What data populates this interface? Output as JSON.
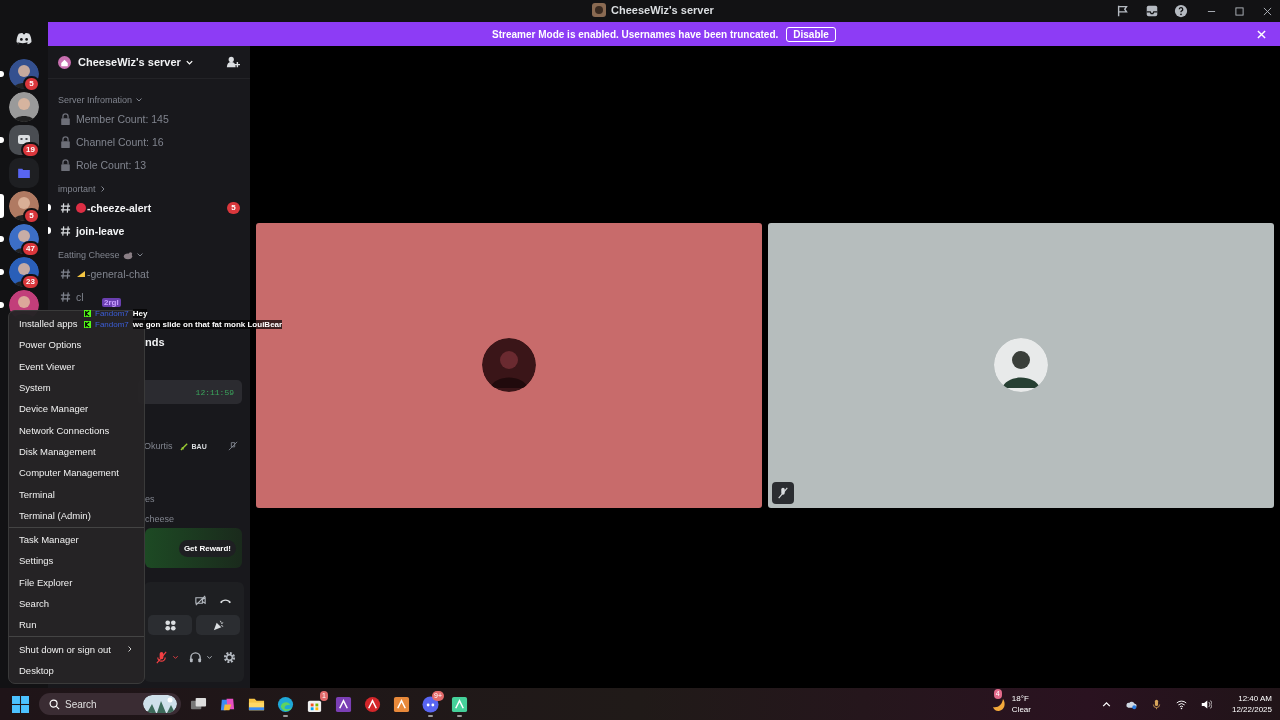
{
  "title_bar": {
    "title": "CheeseWiz's server"
  },
  "banner": {
    "message": "Streamer Mode is enabled. Usernames have been truncated.",
    "button": "Disable"
  },
  "servers": [
    {
      "kind": "picture",
      "badge": "5",
      "unread": true,
      "selected": false
    },
    {
      "kind": "picture",
      "unread": false,
      "selected": false
    },
    {
      "kind": "app",
      "badge": "19",
      "unread": true,
      "selected": false
    },
    {
      "kind": "folder",
      "unread": false,
      "selected": false
    },
    {
      "kind": "picture",
      "badge": "5",
      "selected": true
    },
    {
      "kind": "picture",
      "badge": "47",
      "unread": true,
      "selected": false
    },
    {
      "kind": "picture",
      "badge": "23",
      "unread": true,
      "selected": false
    },
    {
      "kind": "picture",
      "unread": true,
      "selected": false
    }
  ],
  "sidebar": {
    "server_name": "CheeseWiz's server",
    "categories": [
      {
        "name": "Server Infromation",
        "expanded": true,
        "decorated": false,
        "channels": [
          {
            "kind": "locked",
            "name": "Member Count: 145",
            "unread": false
          },
          {
            "kind": "locked",
            "name": "Channel Count: 16",
            "unread": false
          },
          {
            "kind": "locked",
            "name": "Role Count: 13",
            "unread": false
          }
        ]
      },
      {
        "name": "important",
        "expanded": false,
        "decorated": false,
        "channels": [
          {
            "kind": "alert",
            "name": "-cheeze-alert",
            "unread": true,
            "badge": "5"
          },
          {
            "kind": "text",
            "name": "join-leave",
            "unread": true
          }
        ]
      },
      {
        "name": "Eatting Cheese",
        "expanded": true,
        "decorated": true,
        "channels": [
          {
            "kind": "food",
            "name": "-general-chat",
            "unread": false
          },
          {
            "kind": "text",
            "name": "cl",
            "unread": false
          }
        ]
      }
    ],
    "hidden_area": {
      "heading_tail": "nds",
      "timestamp": "12:11:59",
      "member": "Okurtis",
      "member_tag": "BAU",
      "line_a": "es",
      "line_b": "cheese",
      "reward_button": "Get Reward!"
    }
  },
  "overlay_chat": {
    "tag": "2rgl",
    "messages": [
      {
        "author": "Fandom7",
        "text": "Hey"
      },
      {
        "author": "Fandom7",
        "text": "we gon slide on that fat monk LouiBear"
      }
    ]
  },
  "video_tiles": [
    {
      "color": "#c86b6b",
      "muted": false
    },
    {
      "color": "#b6bdbd",
      "muted": true
    }
  ],
  "context_menu": {
    "groups": [
      [
        {
          "label": "Installed apps",
          "submenu": false
        },
        {
          "label": "Power Options",
          "submenu": false
        },
        {
          "label": "Event Viewer",
          "submenu": false
        },
        {
          "label": "System",
          "submenu": false
        },
        {
          "label": "Device Manager",
          "submenu": false
        },
        {
          "label": "Network Connections",
          "submenu": false
        },
        {
          "label": "Disk Management",
          "submenu": false
        },
        {
          "label": "Computer Management",
          "submenu": false
        },
        {
          "label": "Terminal",
          "submenu": false
        },
        {
          "label": "Terminal (Admin)",
          "submenu": false
        }
      ],
      [
        {
          "label": "Task Manager",
          "submenu": false
        },
        {
          "label": "Settings",
          "submenu": false
        },
        {
          "label": "File Explorer",
          "submenu": false
        },
        {
          "label": "Search",
          "submenu": false
        },
        {
          "label": "Run",
          "submenu": false
        }
      ],
      [
        {
          "label": "Shut down or sign out",
          "submenu": true
        },
        {
          "label": "Desktop",
          "submenu": false
        }
      ]
    ]
  },
  "taskbar": {
    "search": {
      "placeholder": "Search"
    },
    "apps": [
      {
        "kind": "taskview",
        "running": false
      },
      {
        "kind": "copilot",
        "running": false
      },
      {
        "kind": "files",
        "running": false
      },
      {
        "kind": "browser",
        "running": true
      },
      {
        "kind": "store",
        "running": false,
        "badge": "1"
      },
      {
        "kind": "purple",
        "running": false
      },
      {
        "kind": "red",
        "running": false
      },
      {
        "kind": "orange",
        "running": false
      },
      {
        "kind": "discord",
        "running": true,
        "badge": "9+"
      },
      {
        "kind": "green",
        "running": true
      }
    ],
    "weather": {
      "badge": "4",
      "temperature": "18°F",
      "condition": "Clear"
    },
    "clock": {
      "time": "12:40 AM",
      "date": "12/22/2025"
    }
  }
}
